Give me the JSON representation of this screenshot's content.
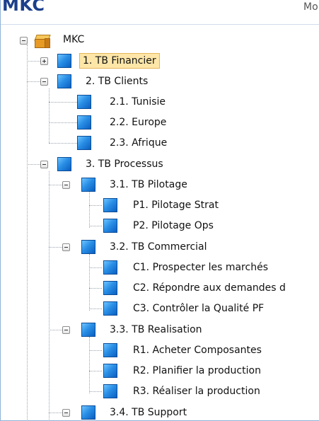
{
  "window": {
    "title": "MKC",
    "title_right_clip": "Mo"
  },
  "tree": {
    "root": "MKC",
    "items": [
      {
        "label": "1. TB Financier",
        "selected": true,
        "expander": "plus"
      },
      {
        "label": "2. TB Clients",
        "expander": "minus"
      },
      {
        "label": "2.1. Tunisie"
      },
      {
        "label": "2.2. Europe"
      },
      {
        "label": "2.3. Afrique"
      },
      {
        "label": "3. TB Processus",
        "expander": "minus"
      },
      {
        "label": "3.1. TB Pilotage",
        "expander": "minus"
      },
      {
        "label": "P1. Pilotage Strat"
      },
      {
        "label": "P2. Pilotage Ops"
      },
      {
        "label": "3.2. TB Commercial",
        "expander": "minus"
      },
      {
        "label": "C1. Prospecter les marchés"
      },
      {
        "label": "C2. Répondre aux demandes d"
      },
      {
        "label": "C3. Contrôler la Qualité PF"
      },
      {
        "label": "3.3. TB Realisation",
        "expander": "minus"
      },
      {
        "label": "R1. Acheter Composantes"
      },
      {
        "label": "R2. Planifier la production"
      },
      {
        "label": "R3. Réaliser la production"
      },
      {
        "label": "3.4. TB Support",
        "expander": "minus"
      }
    ]
  },
  "colors": {
    "accent": "#1b3f8b",
    "selection": "#fde6a8",
    "node_blue": "#2a8fe6"
  }
}
